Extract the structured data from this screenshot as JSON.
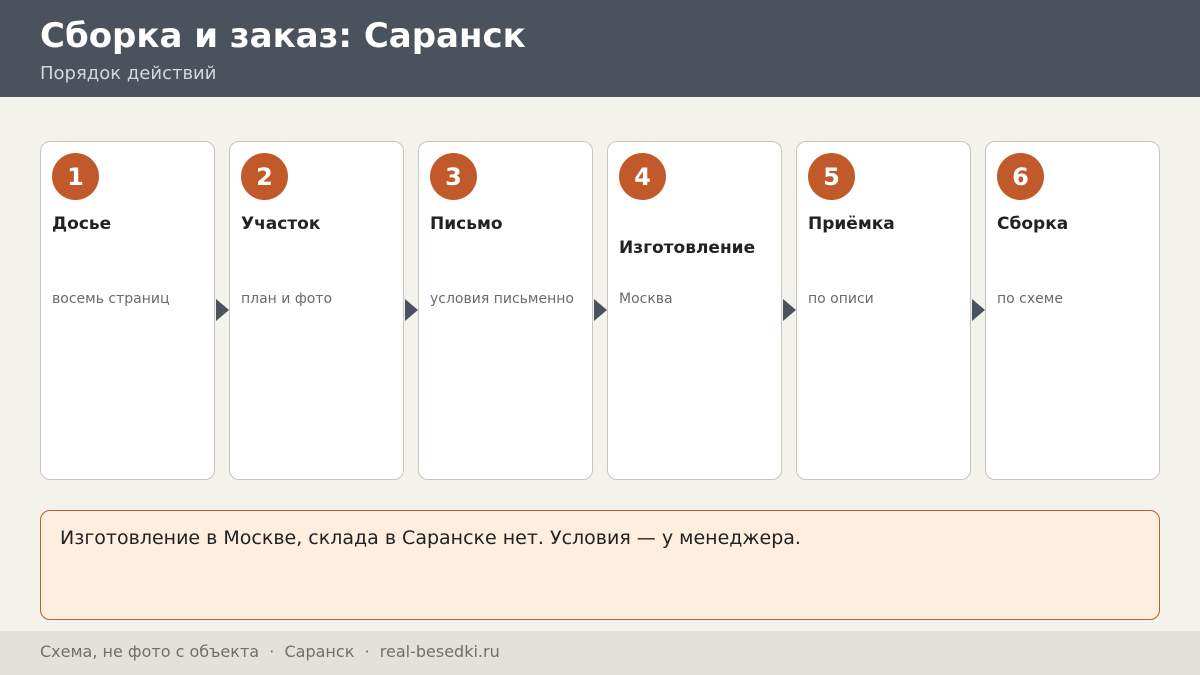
{
  "header": {
    "title": "Сборка и заказ: Саранск",
    "subtitle": "Порядок действий"
  },
  "steps": [
    {
      "number": "1",
      "title": "Досье",
      "description": "восемь страниц"
    },
    {
      "number": "2",
      "title": "Участок",
      "description": "план и фото"
    },
    {
      "number": "3",
      "title": "Письмо",
      "description": "условия письменно"
    },
    {
      "number": "4",
      "title": "Изготовление",
      "description": "Москва"
    },
    {
      "number": "5",
      "title": "Приёмка",
      "description": "по описи"
    },
    {
      "number": "6",
      "title": "Сборка",
      "description": "по схеме"
    }
  ],
  "note": {
    "text": "Изготовление в Москве, склада в Саранске нет. Условия — у менеджера."
  },
  "footer": {
    "text": "Схема, не фото с объекта  ·  Саранск  ·  real-besedki.ru"
  },
  "colors": {
    "header_bg": "#4a525e",
    "accent": "#c2592a",
    "note_bg": "#fdeee0",
    "note_border": "#b5602e"
  }
}
